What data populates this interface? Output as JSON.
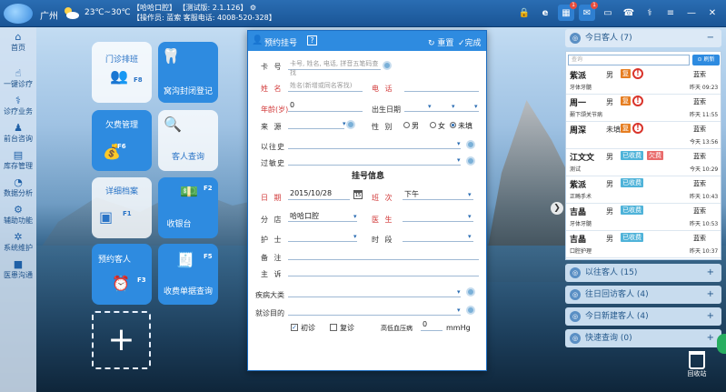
{
  "topbar": {
    "city": "广州",
    "temp": "23℃~30℃",
    "clinic": "【哈哈口腔】",
    "version": "【测试版: 2.1.126】",
    "operator": "【操作员: 蓝索 客服电话: 4008-520-328】"
  },
  "sidebar": [
    {
      "label": "首页",
      "icon": "home-icon"
    },
    {
      "label": "一键诊疗",
      "icon": "hand-icon"
    },
    {
      "label": "诊疗业务",
      "icon": "stethoscope-icon"
    },
    {
      "label": "前台咨询",
      "icon": "reception-icon"
    },
    {
      "label": "库存管理",
      "icon": "inventory-icon"
    },
    {
      "label": "数据分析",
      "icon": "chart-icon"
    },
    {
      "label": "辅助功能",
      "icon": "gear-icon"
    },
    {
      "label": "系统维护",
      "icon": "wrench-icon"
    },
    {
      "label": "医患沟通",
      "icon": "video-icon"
    }
  ],
  "tiles": {
    "schedule": {
      "label": "门诊排班",
      "key": "F8"
    },
    "seal": {
      "label": "窝沟封闭登记"
    },
    "arrears": {
      "label": "欠费管理",
      "key": "F6"
    },
    "search": {
      "label": "客人查询"
    },
    "records": {
      "label": "详细档案",
      "key": "F1"
    },
    "cashier": {
      "label": "收银台",
      "key": "F2"
    },
    "appointment": {
      "label": "预约客人",
      "key": "F3"
    },
    "receipts": {
      "label": "收费单据查询",
      "key": "F5"
    },
    "add": "+"
  },
  "dialog": {
    "title": "预约挂号",
    "help": "?",
    "reset": "重置",
    "done": "完成",
    "card_label": "卡 号",
    "card_placeholder": "卡号, 姓名, 电话, 拼音五笔码查找",
    "name_label": "姓 名",
    "name_placeholder": "姓名(新增或同名客找)",
    "phone_label": "电 话",
    "age_label": "年龄(岁)",
    "age_value": "0",
    "birth_label": "出生日期",
    "source_label": "来 源",
    "gender_label": "性 别",
    "gender_options": [
      "男",
      "女",
      "未填"
    ],
    "history_label": "以往史",
    "allergy_label": "过敏史",
    "reg_section": "挂号信息",
    "date_label": "日 期",
    "date_value": "2015/10/28",
    "shift_label": "班 次",
    "shift_value": "下午",
    "branch_label": "分 店",
    "branch_value": "哈哈口腔",
    "doctor_label": "医 生",
    "nurse_label": "护 士",
    "period_label": "时 段",
    "note_label": "备 注",
    "complaint_label": "主 诉",
    "disease_label": "疾病大类",
    "purpose_label": "就诊目的",
    "first_visit": "初诊",
    "revisit": "复诊",
    "bp_label": "高低血压病",
    "bp_value": "0",
    "bp_unit": "mmHg"
  },
  "right": {
    "today_title": "今日客人 (7)",
    "search_placeholder": "查询",
    "refresh": "刷新",
    "patients": [
      {
        "name": "紫派",
        "sex": "男",
        "tag": "复",
        "tag_color": "#e67e22",
        "alert": "!",
        "proc": "牙体牙髓",
        "doctor": "蓝索",
        "time": "昨天 09:23"
      },
      {
        "name": "周一",
        "sex": "男",
        "tag": "复",
        "tag_color": "#e67e22",
        "alert": "!",
        "proc": "颞下颌关节病",
        "doctor": "蓝索",
        "time": "昨天 11:55"
      },
      {
        "name": "周深",
        "sex": "未填",
        "tag": "复",
        "tag_color": "#e67e22",
        "alert": "!",
        "proc": "",
        "doctor": "蓝索",
        "time": "今天 13:56"
      },
      {
        "name": "江文文",
        "sex": "男",
        "tag": "已收费",
        "tag_color": "#4fb3d9",
        "tag2": "欠费",
        "tag2_color": "#e96b6b",
        "proc": "测试",
        "doctor": "蓝索",
        "time": "今天 10:29"
      },
      {
        "name": "紫派",
        "sex": "男",
        "tag": "已收费",
        "tag_color": "#4fb3d9",
        "proc": "正畸手术",
        "doctor": "蓝索",
        "time": "昨天 10:43"
      },
      {
        "name": "吉晶",
        "sex": "男",
        "tag": "已收费",
        "tag_color": "#4fb3d9",
        "proc": "牙体牙髓",
        "doctor": "蓝索",
        "time": "昨天 10:53"
      },
      {
        "name": "吉晶",
        "sex": "男",
        "tag": "已收费",
        "tag_color": "#4fb3d9",
        "proc": "口腔护理",
        "doctor": "蓝索",
        "time": "昨天 10:37"
      }
    ],
    "past": "以往客人 (15)",
    "revisit": "往日回访客人 (4)",
    "newc": "今日新建客人 (4)",
    "quick": "快速查询 (0)"
  },
  "trash_label": "回收站"
}
